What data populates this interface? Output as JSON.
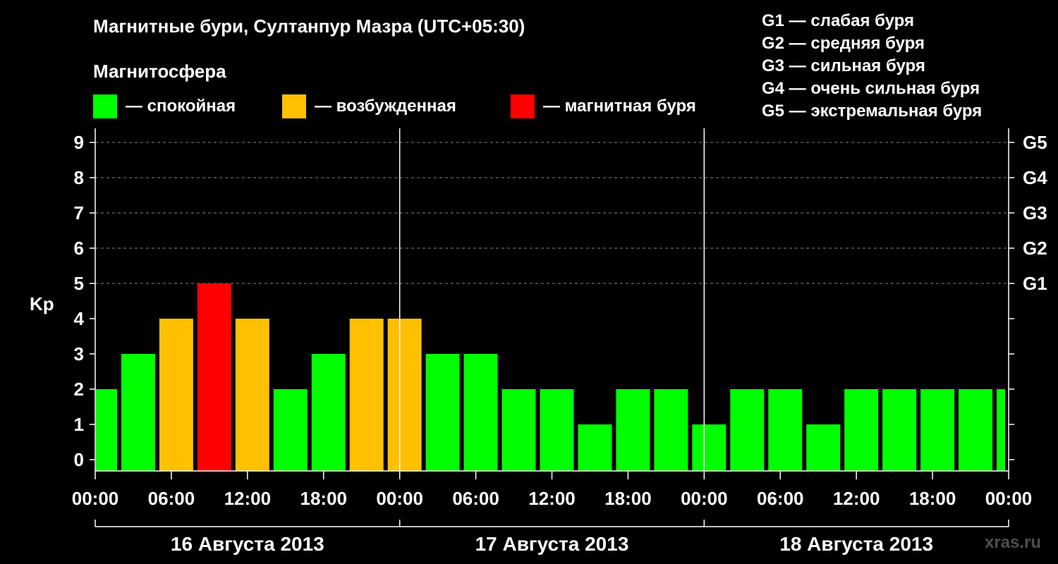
{
  "header": {
    "title": "Магнитные бури, Султанпур Мазра (UTC+05:30)",
    "subtitle": "Магнитосфера"
  },
  "legend": [
    {
      "label": "— спокойная",
      "color": "#00ff00"
    },
    {
      "label": "— возбужденная",
      "color": "#ffc000"
    },
    {
      "label": "— магнитная буря",
      "color": "#ff0000"
    }
  ],
  "storm_scale": [
    "G1 — слабая буря",
    "G2 — средняя буря",
    "G3 — сильная буря",
    "G4 — очень сильная буря",
    "G5 — экстремальная буря"
  ],
  "watermark": "xras.ru",
  "chart_data": {
    "type": "bar",
    "ylabel": "Kp",
    "ylim": [
      0,
      9
    ],
    "yticks": [
      "0",
      "1",
      "2",
      "3",
      "4",
      "5",
      "6",
      "7",
      "8",
      "9"
    ],
    "right_ticks": [
      {
        "value": 5,
        "label": "G1"
      },
      {
        "value": 6,
        "label": "G2"
      },
      {
        "value": 7,
        "label": "G3"
      },
      {
        "value": 8,
        "label": "G4"
      },
      {
        "value": 9,
        "label": "G5"
      }
    ],
    "xticks": [
      "00:00",
      "06:00",
      "12:00",
      "18:00",
      "00:00",
      "06:00",
      "12:00",
      "18:00",
      "00:00",
      "06:00",
      "12:00",
      "18:00",
      "00:00"
    ],
    "days": [
      "16 Августа 2013",
      "17 Августа 2013",
      "18 Августа 2013"
    ],
    "x_start": "2013-08-16 00:00",
    "x_end": "2013-08-19 00:00",
    "bars": [
      {
        "start": "2013-08-16 00:00",
        "end": "2013-08-16 02:00",
        "kp": 2
      },
      {
        "start": "2013-08-16 02:00",
        "end": "2013-08-16 05:00",
        "kp": 3
      },
      {
        "start": "2013-08-16 05:00",
        "end": "2013-08-16 08:00",
        "kp": 4
      },
      {
        "start": "2013-08-16 08:00",
        "end": "2013-08-16 11:00",
        "kp": 5
      },
      {
        "start": "2013-08-16 11:00",
        "end": "2013-08-16 14:00",
        "kp": 4
      },
      {
        "start": "2013-08-16 14:00",
        "end": "2013-08-16 17:00",
        "kp": 2
      },
      {
        "start": "2013-08-16 17:00",
        "end": "2013-08-16 20:00",
        "kp": 3
      },
      {
        "start": "2013-08-16 20:00",
        "end": "2013-08-16 23:00",
        "kp": 4
      },
      {
        "start": "2013-08-16 23:00",
        "end": "2013-08-17 02:00",
        "kp": 4
      },
      {
        "start": "2013-08-17 02:00",
        "end": "2013-08-17 05:00",
        "kp": 3
      },
      {
        "start": "2013-08-17 05:00",
        "end": "2013-08-17 08:00",
        "kp": 3
      },
      {
        "start": "2013-08-17 08:00",
        "end": "2013-08-17 11:00",
        "kp": 2
      },
      {
        "start": "2013-08-17 11:00",
        "end": "2013-08-17 14:00",
        "kp": 2
      },
      {
        "start": "2013-08-17 14:00",
        "end": "2013-08-17 17:00",
        "kp": 1
      },
      {
        "start": "2013-08-17 17:00",
        "end": "2013-08-17 20:00",
        "kp": 2
      },
      {
        "start": "2013-08-17 20:00",
        "end": "2013-08-17 23:00",
        "kp": 2
      },
      {
        "start": "2013-08-17 23:00",
        "end": "2013-08-18 02:00",
        "kp": 1
      },
      {
        "start": "2013-08-18 02:00",
        "end": "2013-08-18 05:00",
        "kp": 2
      },
      {
        "start": "2013-08-18 05:00",
        "end": "2013-08-18 08:00",
        "kp": 2
      },
      {
        "start": "2013-08-18 08:00",
        "end": "2013-08-18 11:00",
        "kp": 1
      },
      {
        "start": "2013-08-18 11:00",
        "end": "2013-08-18 14:00",
        "kp": 2
      },
      {
        "start": "2013-08-18 14:00",
        "end": "2013-08-18 17:00",
        "kp": 2
      },
      {
        "start": "2013-08-18 17:00",
        "end": "2013-08-18 20:00",
        "kp": 2
      },
      {
        "start": "2013-08-18 20:00",
        "end": "2013-08-18 23:00",
        "kp": 2
      },
      {
        "start": "2013-08-18 23:00",
        "end": "2013-08-19 00:00",
        "kp": 2
      }
    ],
    "grid": "dashed horizontal",
    "colors": {
      "quiet": "#00ff00",
      "active": "#ffc000",
      "storm": "#ff0000"
    }
  }
}
